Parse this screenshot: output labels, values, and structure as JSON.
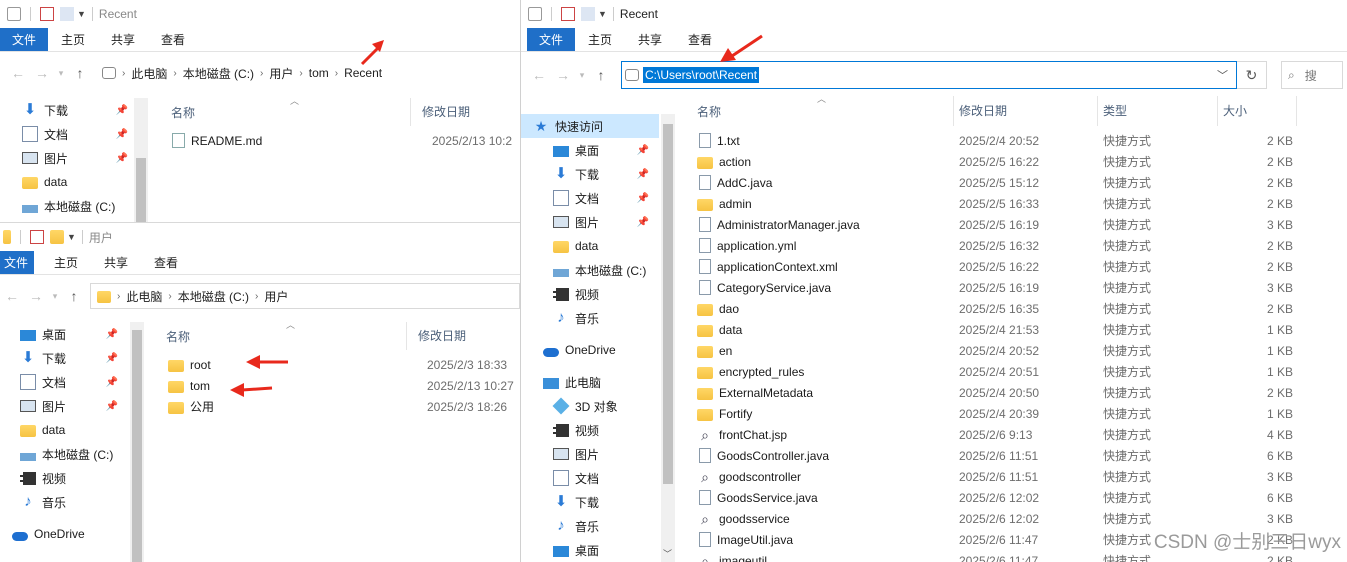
{
  "ribbon": {
    "file": "文件",
    "home": "主页",
    "share": "共享",
    "view": "查看"
  },
  "win1": {
    "title": "Recent",
    "crumbs": [
      "此电脑",
      "本地磁盘 (C:)",
      "用户",
      "tom",
      "Recent"
    ],
    "nav": [
      "下载",
      "文档",
      "图片",
      "data",
      "本地磁盘 (C:)"
    ],
    "col_name": "名称",
    "col_date": "修改日期",
    "files": [
      {
        "name": "README.md",
        "date": "2025/2/13 10:2"
      }
    ]
  },
  "win2": {
    "title": "用户",
    "crumbs": [
      "此电脑",
      "本地磁盘 (C:)",
      "用户"
    ],
    "nav": [
      "桌面",
      "下载",
      "文档",
      "图片",
      "data",
      "本地磁盘 (C:)",
      "视频",
      "音乐",
      "OneDrive"
    ],
    "col_name": "名称",
    "col_date": "修改日期",
    "files": [
      {
        "name": "root",
        "date": "2025/2/3 18:33"
      },
      {
        "name": "tom",
        "date": "2025/2/13 10:27"
      },
      {
        "name": "公用",
        "date": "2025/2/3 18:26"
      }
    ]
  },
  "win3": {
    "title": "Recent",
    "address": "C:\\Users\\root\\Recent",
    "search": "搜",
    "quick_access": "快速访问",
    "nav": [
      "桌面",
      "下载",
      "文档",
      "图片",
      "data",
      "本地磁盘 (C:)",
      "视频",
      "音乐"
    ],
    "onedrive": "OneDrive",
    "thispc": "此电脑",
    "pc_items": [
      "3D 对象",
      "视频",
      "图片",
      "文档",
      "下载",
      "音乐",
      "桌面"
    ],
    "col_name": "名称",
    "col_date": "修改日期",
    "col_type": "类型",
    "col_size": "大小",
    "files": [
      {
        "name": "1.txt",
        "date": "2025/2/4 20:52",
        "type": "快捷方式",
        "size": "2 KB",
        "icon": "file"
      },
      {
        "name": "action",
        "date": "2025/2/5 16:22",
        "type": "快捷方式",
        "size": "2 KB",
        "icon": "folder"
      },
      {
        "name": "AddC.java",
        "date": "2025/2/5 15:12",
        "type": "快捷方式",
        "size": "2 KB",
        "icon": "file"
      },
      {
        "name": "admin",
        "date": "2025/2/5 16:33",
        "type": "快捷方式",
        "size": "2 KB",
        "icon": "folder"
      },
      {
        "name": "AdministratorManager.java",
        "date": "2025/2/5 16:19",
        "type": "快捷方式",
        "size": "3 KB",
        "icon": "file"
      },
      {
        "name": "application.yml",
        "date": "2025/2/5 16:32",
        "type": "快捷方式",
        "size": "2 KB",
        "icon": "file"
      },
      {
        "name": "applicationContext.xml",
        "date": "2025/2/5 16:22",
        "type": "快捷方式",
        "size": "2 KB",
        "icon": "file"
      },
      {
        "name": "CategoryService.java",
        "date": "2025/2/5 16:19",
        "type": "快捷方式",
        "size": "3 KB",
        "icon": "file"
      },
      {
        "name": "dao",
        "date": "2025/2/5 16:35",
        "type": "快捷方式",
        "size": "2 KB",
        "icon": "folder"
      },
      {
        "name": "data",
        "date": "2025/2/4 21:53",
        "type": "快捷方式",
        "size": "1 KB",
        "icon": "folder"
      },
      {
        "name": "en",
        "date": "2025/2/4 20:52",
        "type": "快捷方式",
        "size": "1 KB",
        "icon": "folder"
      },
      {
        "name": "encrypted_rules",
        "date": "2025/2/4 20:51",
        "type": "快捷方式",
        "size": "1 KB",
        "icon": "folder"
      },
      {
        "name": "ExternalMetadata",
        "date": "2025/2/4 20:50",
        "type": "快捷方式",
        "size": "2 KB",
        "icon": "folder"
      },
      {
        "name": "Fortify",
        "date": "2025/2/4 20:39",
        "type": "快捷方式",
        "size": "1 KB",
        "icon": "folder"
      },
      {
        "name": "frontChat.jsp",
        "date": "2025/2/6 9:13",
        "type": "快捷方式",
        "size": "4 KB",
        "icon": "search"
      },
      {
        "name": "GoodsController.java",
        "date": "2025/2/6 11:51",
        "type": "快捷方式",
        "size": "6 KB",
        "icon": "file"
      },
      {
        "name": "goodscontroller",
        "date": "2025/2/6 11:51",
        "type": "快捷方式",
        "size": "3 KB",
        "icon": "search"
      },
      {
        "name": "GoodsService.java",
        "date": "2025/2/6 12:02",
        "type": "快捷方式",
        "size": "6 KB",
        "icon": "file"
      },
      {
        "name": "goodsservice",
        "date": "2025/2/6 12:02",
        "type": "快捷方式",
        "size": "3 KB",
        "icon": "search"
      },
      {
        "name": "ImageUtil.java",
        "date": "2025/2/6 11:47",
        "type": "快捷方式",
        "size": "2 KB",
        "icon": "file"
      },
      {
        "name": "imageutil",
        "date": "2025/2/6 11:47",
        "type": "快捷方式",
        "size": "2 KB",
        "icon": "search"
      }
    ],
    "watermark": "CSDN @士别三日wyx"
  }
}
